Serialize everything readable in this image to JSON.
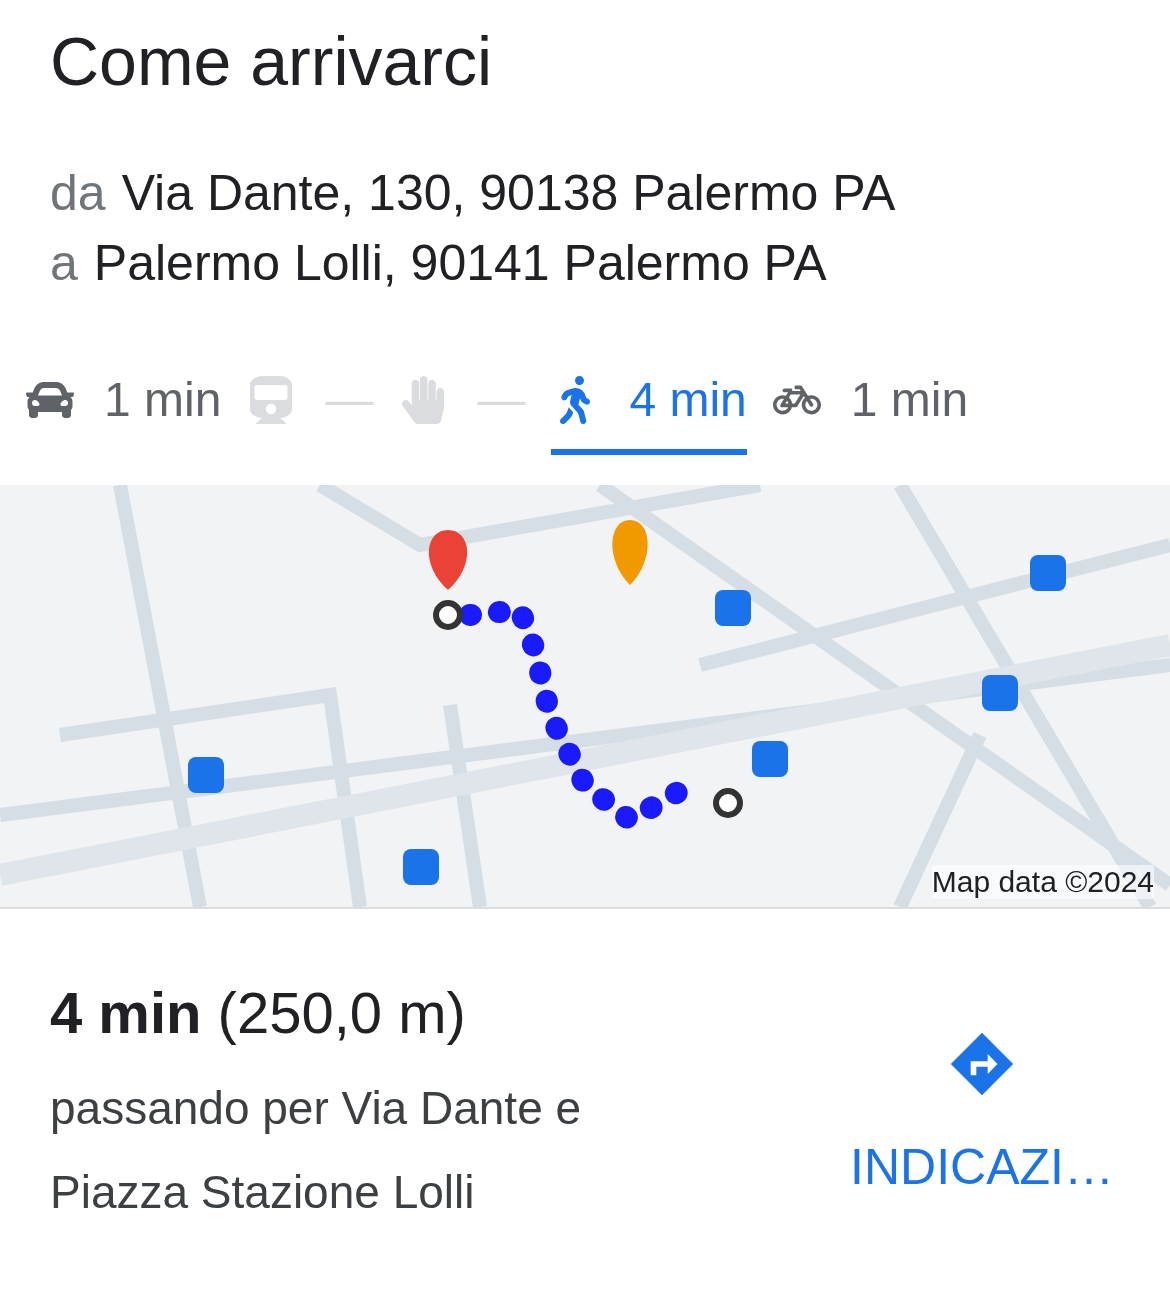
{
  "title": "Come arrivarci",
  "route": [
    {
      "prefix": "da",
      "address": "Via Dante, 130, 90138 Palermo PA"
    },
    {
      "prefix": "a",
      "address": "Palermo Lolli, 90141 Palermo PA"
    }
  ],
  "modes": [
    {
      "kind": "car",
      "time": "1 min",
      "selected": false,
      "disabled": false
    },
    {
      "kind": "train",
      "time": "—",
      "selected": false,
      "disabled": true
    },
    {
      "kind": "ride",
      "time": "—",
      "selected": false,
      "disabled": true
    },
    {
      "kind": "walk",
      "time": "4 min",
      "selected": true,
      "disabled": false
    },
    {
      "kind": "bike",
      "time": "1 min",
      "selected": false,
      "disabled": false
    }
  ],
  "map": {
    "kind": "picture",
    "attribution": "Map data ©2024"
  },
  "summary": {
    "duration": "**4 min** (250,0 m)",
    "via": "passando per Via Dante e Piazza Stazione Lolli"
  },
  "directions_button": "INDICAZI…"
}
